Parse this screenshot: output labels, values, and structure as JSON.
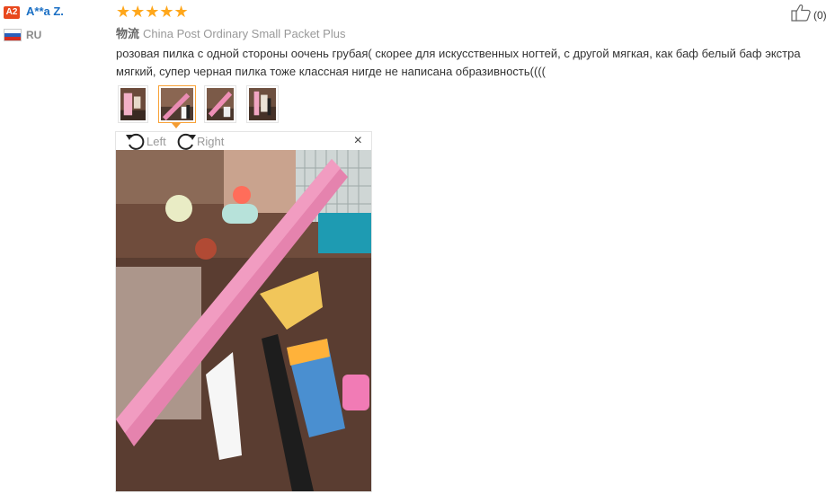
{
  "reviewer": {
    "level_badge": "A2",
    "name": "A**a Z.",
    "country": "RU"
  },
  "rating": {
    "stars": 5,
    "stars_text": "★★★★★"
  },
  "helpful": {
    "count": "(0)"
  },
  "shipping": {
    "label": "物流",
    "method": "China Post Ordinary Small Packet Plus"
  },
  "review_text": "розовая пилка с одной стороны оочень грубая( скорее для искусственных ногтей, с другой мягкая, как баф белый баф экстра мягкий, супер черная пилка тоже классная нигде не написана образивность((((",
  "gallery": {
    "thumbnails": [
      "photo-1",
      "photo-2",
      "photo-3",
      "photo-4"
    ],
    "active_index": 1,
    "rotate_left": "Left",
    "rotate_right": "Right",
    "close": "×"
  },
  "colors": {
    "accent_orange": "#f9a237",
    "star": "#ffa71b",
    "link_blue": "#1a6fc4",
    "badge_red": "#e8481d"
  }
}
